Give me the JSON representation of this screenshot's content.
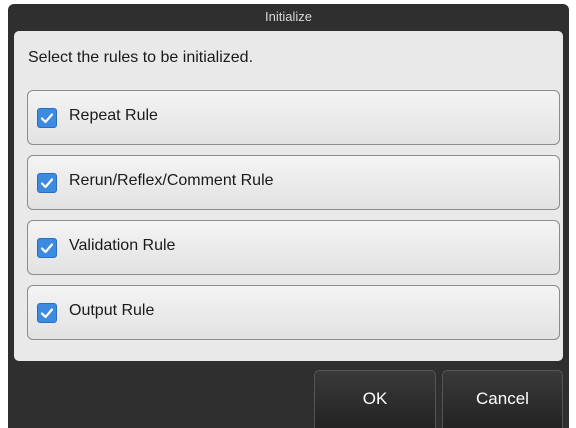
{
  "dialog": {
    "title": "Initialize",
    "instruction": "Select the rules to be initialized.",
    "rules": [
      {
        "label": "Repeat Rule",
        "checked": true,
        "icon": "checkmark-icon"
      },
      {
        "label": "Rerun/Reflex/Comment Rule",
        "checked": true,
        "icon": "checkmark-icon"
      },
      {
        "label": "Validation Rule",
        "checked": true,
        "icon": "checkmark-icon"
      },
      {
        "label": "Output Rule",
        "checked": true,
        "icon": "checkmark-icon"
      }
    ],
    "buttons": {
      "ok": "OK",
      "cancel": "Cancel"
    }
  },
  "colors": {
    "frame": "#2f2f2f",
    "content_bg": "#e9e9e9",
    "checkbox_accent": "#3d8be0"
  }
}
